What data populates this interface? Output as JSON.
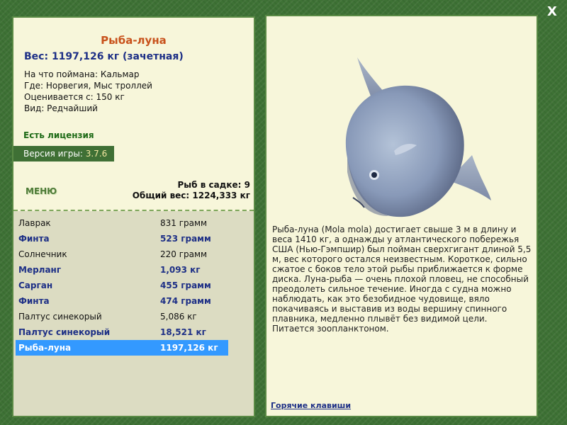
{
  "fish": {
    "title": "Рыба-луна",
    "weight": "Вес: 1197,126 кг (зачетная)",
    "caught_on": "На что поймана: Кальмар",
    "location": "Где: Норвегия, Мыс троллей",
    "valued": "Оценивается с: 150 кг",
    "kind": "Вид: Редчайший"
  },
  "license": "Есть лицензия",
  "version": {
    "label": "Версия игры:",
    "value": "3.7.6"
  },
  "menu_label": "МЕНЮ",
  "cage": {
    "count": "Рыб в садке: 9",
    "total": "Общий вес: 1224,333 кг"
  },
  "catch_list": [
    {
      "name": "Лаврак",
      "weight": "831 грамм",
      "bold": false
    },
    {
      "name": "Финта",
      "weight": "523 грамм",
      "bold": true
    },
    {
      "name": "Солнечник",
      "weight": "220 грамм",
      "bold": false
    },
    {
      "name": "Мерланг",
      "weight": "1,093 кг",
      "bold": true
    },
    {
      "name": "Сарган",
      "weight": "455 грамм",
      "bold": true
    },
    {
      "name": "Финта",
      "weight": "474 грамм",
      "bold": true
    },
    {
      "name": "Палтус синекорый",
      "weight": "5,086 кг",
      "bold": false
    },
    {
      "name": "Палтус синекорый",
      "weight": "18,521 кг",
      "bold": true
    },
    {
      "name": "Рыба-луна",
      "weight": "1197,126 кг",
      "bold": true,
      "selected": true
    }
  ],
  "description": "Рыба-луна (Mola mola) достигает свыше 3 м в длину и веса 1410 кг, а однажды у атлантического побережья США (Нью-Гэмпшир) был пойман сверхгигант длиной 5,5 м, вес которого остался неизвестным. Короткое, сильно сжатое с боков тело этой рыбы приближается к форме диска. Луна-рыба — очень плохой пловец, не способный преодолеть сильное течение. Иногда с судна можно наблюдать, как это безобидное чудовище, вяло покачиваясь и выставив из воды вершину спинного плавника, медленно плывёт без видимой цели. Питается зоопланктоном.",
  "hotkeys_label": "Горячие клавиши",
  "close_label": "X",
  "icons": {
    "close": "close-icon"
  },
  "colors": {
    "background": "#3e7235",
    "panel": "#f7f6da",
    "title": "#c8521c",
    "accent_blue": "#1d2f86",
    "selection": "#3399ff"
  }
}
